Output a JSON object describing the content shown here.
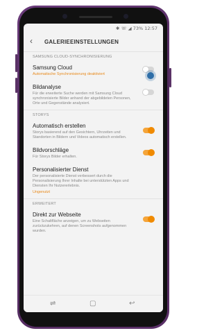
{
  "status": {
    "icons": "✱ ☏ ◢",
    "battery": "73%",
    "time": "12:57"
  },
  "header": {
    "title": "GALERIEEINSTELLUNGEN",
    "back_icon": "back-arrow-icon"
  },
  "sections": {
    "cloud": "SAMSUNG CLOUD-SYNCHRONISIERUNG",
    "storys": "STORYS",
    "erweitert": "ERWEITERT"
  },
  "items": {
    "samsung_cloud": {
      "title": "Samsung Cloud",
      "sub": "Automatische Synchronisierung deaktiviert",
      "state": "off"
    },
    "bildanalyse": {
      "title": "Bildanalyse",
      "sub": "Für die erweiterte Suche werden mit Samsung Cloud synchronisierte Bilder anhand der abgebildeten Personen, Orte und Gegenstände analysiert.",
      "state": "off"
    },
    "auto_erstellen": {
      "title": "Automatisch erstellen",
      "sub": "Storys basierend auf den Gesichtern, Uhrzeiten und Standorten in Bildern und Videos automatisch erstellen.",
      "state": "on"
    },
    "bildvorschlaege": {
      "title": "Bildvorschläge",
      "sub": "Für Storys Bilder erhalten.",
      "state": "on"
    },
    "personalisiert": {
      "title": "Personalisierter Dienst",
      "sub": "Der personalisierte Dienst verbessert durch die Personalisierung Ihrer Inhalte bei unterstützten Apps und Diensten Ihr Nutzererlebnis.",
      "status": "Ungenutzt"
    },
    "direkt_webseite": {
      "title": "Direkt zur Webseite",
      "sub": "Eine Schaltfläche anzeigen, um zu Webseiten zurückzukehren, auf denen Screenshots aufgenommen wurden.",
      "state": "on"
    }
  },
  "nav": {
    "recent": "⇌",
    "home": "▢",
    "back": "↩"
  },
  "colors": {
    "accent": "#f08a00",
    "toggle_off": "#d6d6d6",
    "phone": "#5a3266"
  }
}
